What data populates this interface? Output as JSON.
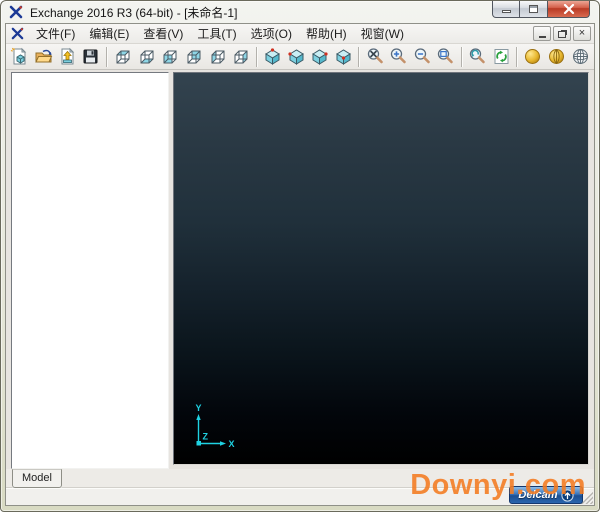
{
  "window": {
    "title": "Exchange 2016 R3 (64-bit) - [未命名-1]",
    "controls": {
      "minimize": "minimize",
      "maximize": "maximize",
      "close": "close"
    }
  },
  "menu": {
    "items": [
      {
        "label": "文件(F)"
      },
      {
        "label": "编辑(E)"
      },
      {
        "label": "查看(V)"
      },
      {
        "label": "工具(T)"
      },
      {
        "label": "选项(O)"
      },
      {
        "label": "帮助(H)"
      },
      {
        "label": "视窗(W)"
      }
    ]
  },
  "mdi": {
    "close_glyph": "×"
  },
  "toolbar": {
    "groups": [
      {
        "name": "file",
        "icons": [
          "new-file-icon",
          "open-file-icon",
          "import-file-icon",
          "save-file-icon"
        ]
      },
      {
        "name": "face-views",
        "icons": [
          "view-top-icon",
          "view-bottom-icon",
          "view-front-icon",
          "view-back-icon",
          "view-left-icon",
          "view-right-icon"
        ]
      },
      {
        "name": "iso-views",
        "icons": [
          "iso-view-1-icon",
          "iso-view-2-icon",
          "iso-view-3-icon",
          "iso-view-4-icon"
        ]
      },
      {
        "name": "zoom",
        "icons": [
          "zoom-fit-icon",
          "zoom-in-icon",
          "zoom-out-icon",
          "zoom-window-icon"
        ]
      },
      {
        "name": "refresh",
        "icons": [
          "zoom-previous-icon",
          "refresh-view-icon"
        ]
      },
      {
        "name": "render",
        "icons": [
          "shaded-view-icon",
          "shaded-edges-view-icon",
          "wireframe-view-icon"
        ]
      }
    ]
  },
  "viewport": {
    "axis": {
      "x": "X",
      "y": "Y",
      "z": "Z"
    },
    "axis_color": "#1fd2e2"
  },
  "bottom": {
    "model_tab": "Model"
  },
  "status": {
    "watermark": "Downyi.com",
    "logo_text": "Delcam"
  },
  "colors": {
    "icon_cyan": "#7fd4e4",
    "close_button": "#c94a34",
    "watermark_orange": "#f47b20",
    "logo_blue": "#2a66ae",
    "viewport_top": "#33434f",
    "viewport_bottom": "#000000"
  }
}
